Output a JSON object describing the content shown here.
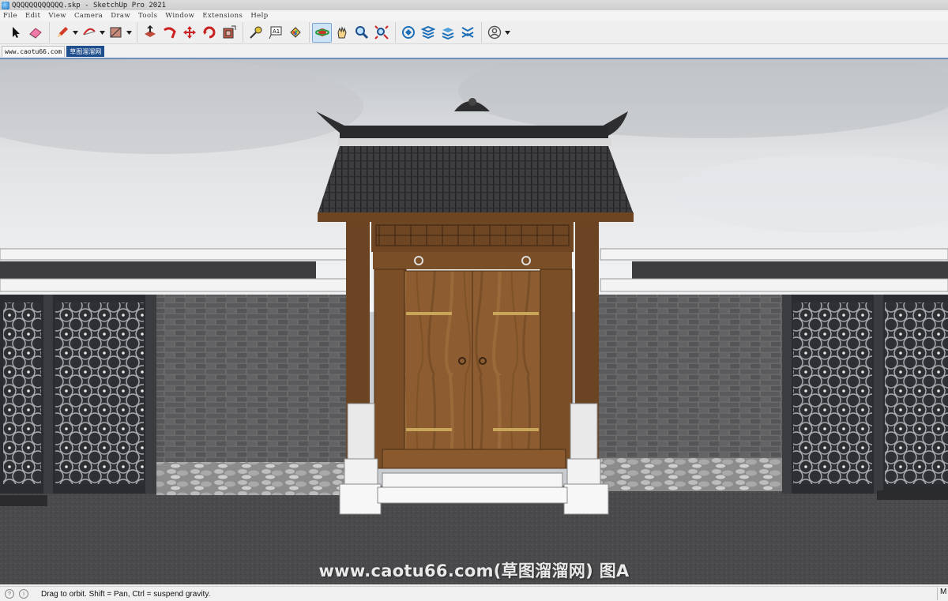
{
  "window": {
    "title": "QQQQQQQQQQQQ.skp - SketchUp Pro 2021"
  },
  "menu": {
    "items": [
      "File",
      "Edit",
      "View",
      "Camera",
      "Draw",
      "Tools",
      "Window",
      "Extensions",
      "Help"
    ]
  },
  "toolbar": {
    "tools": [
      "select-icon",
      "eraser-icon",
      "pencil-icon",
      "arc-icon",
      "rectangle-icon",
      "push-pull-icon",
      "follow-me-icon",
      "move-icon",
      "rotate-icon",
      "offset-icon",
      "tape-measure-icon",
      "text-icon",
      "paint-bucket-icon",
      "orbit-icon",
      "pan-icon",
      "zoom-icon",
      "zoom-extents-icon",
      "3d-warehouse-icon",
      "extension-warehouse-icon",
      "layout-icon",
      "style-builder-icon",
      "account-icon"
    ],
    "active_tool": "orbit-icon"
  },
  "scene_tabs": [
    "www.caotu66.com",
    "草图溜溜网"
  ],
  "selected_tab": "草图溜溜网",
  "viewport": {
    "watermark": "www.caotu66.com(草图溜溜网) 图A"
  },
  "status": {
    "message": "Drag to orbit. Shift = Pan, Ctrl = suspend gravity.",
    "measurements_label": "M"
  },
  "colors": {
    "selected_tab": "#1f4e8c",
    "roof_tile": "#3b3b3d",
    "door_wood": "#8a5a2e",
    "brick": "#5a5a5a"
  }
}
